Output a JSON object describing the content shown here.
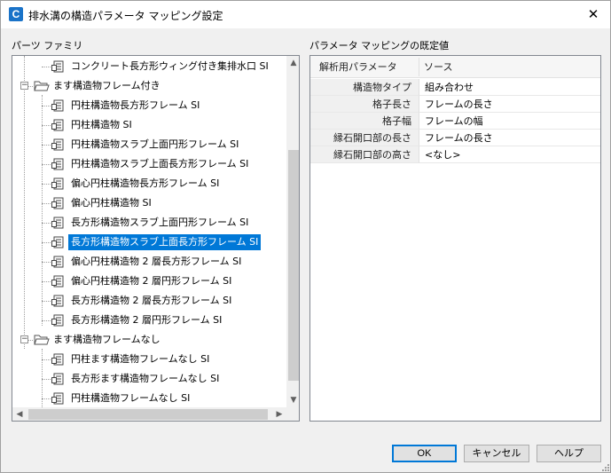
{
  "window": {
    "title": "排水溝の構造パラメータ マッピング設定",
    "close_glyph": "✕",
    "app_icon_letter": "C"
  },
  "left_panel": {
    "label": "パーツ ファミリ",
    "tree": [
      {
        "text": "コンクリート長方形ウィング付き集排水口 SI",
        "level": 2,
        "type": "part"
      },
      {
        "text": "ます構造物フレーム付き",
        "level": 1,
        "type": "folder",
        "expanded": true
      },
      {
        "text": "円柱構造物長方形フレーム SI",
        "level": 2,
        "type": "part"
      },
      {
        "text": "円柱構造物 SI",
        "level": 2,
        "type": "part"
      },
      {
        "text": "円柱構造物スラブ上面円形フレーム SI",
        "level": 2,
        "type": "part"
      },
      {
        "text": "円柱構造物スラブ上面長方形フレーム SI",
        "level": 2,
        "type": "part"
      },
      {
        "text": "偏心円柱構造物長方形フレーム SI",
        "level": 2,
        "type": "part"
      },
      {
        "text": "偏心円柱構造物 SI",
        "level": 2,
        "type": "part"
      },
      {
        "text": "長方形構造物スラブ上面円形フレーム SI",
        "level": 2,
        "type": "part"
      },
      {
        "text": "長方形構造物スラブ上面長方形フレーム SI",
        "level": 2,
        "type": "part",
        "selected": true
      },
      {
        "text": "偏心円柱構造物 2 層長方形フレーム SI",
        "level": 2,
        "type": "part"
      },
      {
        "text": "偏心円柱構造物 2 層円形フレーム SI",
        "level": 2,
        "type": "part"
      },
      {
        "text": "長方形構造物 2 層長方形フレーム SI",
        "level": 2,
        "type": "part"
      },
      {
        "text": "長方形構造物 2 層円形フレーム SI",
        "level": 2,
        "type": "part"
      },
      {
        "text": "ます構造物フレームなし",
        "level": 1,
        "type": "folder",
        "expanded": true
      },
      {
        "text": "円柱ます構造物フレームなし SI",
        "level": 2,
        "type": "part"
      },
      {
        "text": "長方形ます構造物フレームなし SI",
        "level": 2,
        "type": "part"
      },
      {
        "text": "円柱構造物フレームなし SI",
        "level": 2,
        "type": "part"
      }
    ]
  },
  "right_panel": {
    "label": "パラメータ マッピングの既定値",
    "columns": [
      "解析用パラメータ",
      "ソース"
    ],
    "rows": [
      {
        "param": "構造物タイプ",
        "source": "組み合わせ"
      },
      {
        "param": "格子長さ",
        "source": "フレームの長さ"
      },
      {
        "param": "格子幅",
        "source": "フレームの幅"
      },
      {
        "param": "縁石開口部の長さ",
        "source": "フレームの長さ"
      },
      {
        "param": "縁石開口部の高さ",
        "source": "<なし>"
      }
    ]
  },
  "buttons": {
    "ok": "OK",
    "cancel": "キャンセル",
    "help": "ヘルプ"
  },
  "colors": {
    "selection": "#0078d7",
    "default_button_border": "#0078d7"
  }
}
